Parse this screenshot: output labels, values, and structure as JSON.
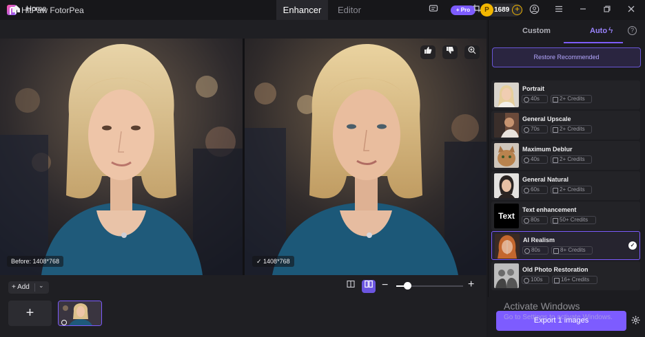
{
  "app": {
    "title": "HitPaw FotorPea"
  },
  "main_tabs": {
    "enhancer": "Enhancer",
    "editor": "Editor"
  },
  "titlebar": {
    "pro_label": "+ Pro",
    "coins": "1689"
  },
  "toolbar": {
    "home_label": "Home"
  },
  "preview": {
    "before_label": "Before: 1408*768",
    "after_label": "✓ 1408*768"
  },
  "bottom": {
    "add_label": "+ Add"
  },
  "panel": {
    "tab_custom": "Custom",
    "tab_auto": "Auto",
    "restore_label": "Restore Recommended",
    "models": [
      {
        "name": "Portrait",
        "time": "40s",
        "credits": "2+ Credits"
      },
      {
        "name": "General Upscale",
        "time": "70s",
        "credits": "2+ Credits"
      },
      {
        "name": "Maximum Deblur",
        "time": "40s",
        "credits": "2+ Credits"
      },
      {
        "name": "General Natural",
        "time": "60s",
        "credits": "2+ Credits"
      },
      {
        "name": "Text enhancement",
        "time": "80s",
        "credits": "50+ Credits",
        "thumb_text": "Text"
      },
      {
        "name": "AI Realism",
        "time": "80s",
        "credits": "8+ Credits",
        "selected": true
      },
      {
        "name": "Old Photo Restoration",
        "time": "100s",
        "credits": "16+ Credits"
      }
    ],
    "export_label": "Export 1 images"
  },
  "watermark": {
    "title": "Activate Windows",
    "subtitle": "Go to Settings to activate Windows."
  },
  "colors": {
    "accent": "#7d5cff",
    "background": "#1b1b1f",
    "panel": "#1c1c20"
  }
}
